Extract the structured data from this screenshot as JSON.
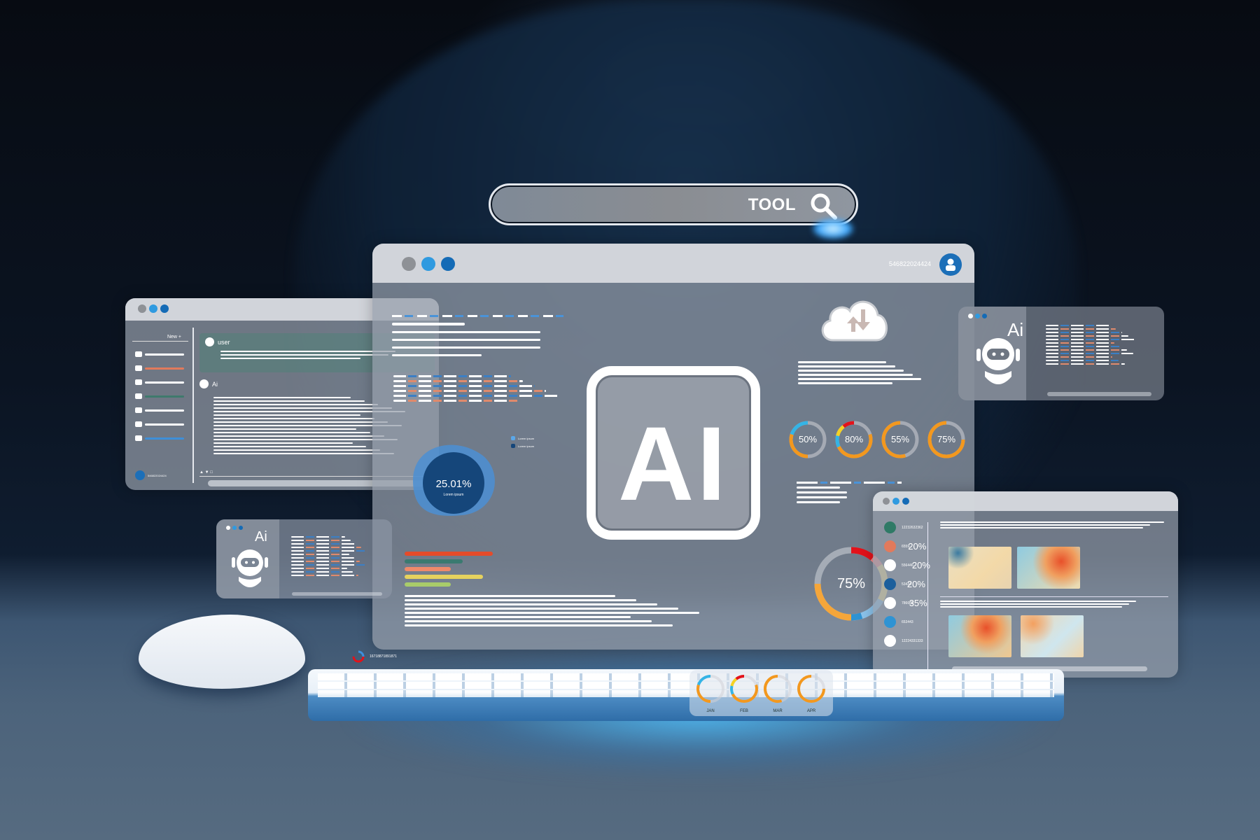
{
  "search": {
    "label": "TOOL",
    "icon": "search-icon"
  },
  "main_window": {
    "user_id": "546822024424",
    "logo_text": "AI",
    "donut": {
      "value": "25.01%",
      "caption": "Lorem ipsum"
    },
    "legend": [
      {
        "label": "Lorem ipsum",
        "color": "#5ba7e8"
      },
      {
        "label": "Lorem ipsum",
        "color": "#15467a"
      }
    ],
    "progress_rings": [
      {
        "label": "50%",
        "value": 50,
        "colors": [
          "#f3981e",
          "#34b4e6"
        ]
      },
      {
        "label": "80%",
        "value": 80,
        "colors": [
          "#f3981e",
          "#34b4e6",
          "#f5d224",
          "#e3121a"
        ]
      },
      {
        "label": "55%",
        "value": 55,
        "colors": [
          "#f3981e"
        ]
      },
      {
        "label": "75%",
        "value": 75,
        "colors": [
          "#f3981e"
        ]
      }
    ],
    "big_ring": {
      "label": "75%",
      "value": 75
    },
    "bar_chart": [
      {
        "color": "#e54b2a",
        "value": 100
      },
      {
        "color": "#3a7a70",
        "value": 66
      },
      {
        "color": "#ee8a6a",
        "value": 52
      },
      {
        "color": "#e6d25e",
        "value": 89
      },
      {
        "color": "#a9cc6a",
        "value": 52
      }
    ],
    "cloud_icon": "cloud-sync-icon"
  },
  "chat_window": {
    "new_label": "New +",
    "user_label": "user",
    "ai_label": "Ai",
    "footer_id": "546822024424",
    "side_item_colors": [
      "#ffffff",
      "#e27a5c",
      "#ffffff",
      "#3f7a6c",
      "#ffffff",
      "#ffffff",
      "#3e8fd8"
    ]
  },
  "ai_card_right": {
    "label": "Ai"
  },
  "ai_card_left": {
    "label": "Ai"
  },
  "lower_right_window": {
    "contacts": [
      {
        "id": "12232632362",
        "color": "#2f7a66"
      },
      {
        "id": "6559...",
        "color": "#e27a5c",
        "pct": "20%"
      },
      {
        "id": "556446...",
        "color": "#ffffff",
        "pct": "20%"
      },
      {
        "id": "53434",
        "color": "#1c5f9c",
        "pct": "20%"
      },
      {
        "id": "786668",
        "color": "#ffffff",
        "pct": "35%"
      },
      {
        "id": "653443",
        "color": "#2f93d3"
      },
      {
        "id": "12224331333",
        "color": "#ffffff"
      }
    ]
  },
  "keyboard_panel": {
    "id_text": "16718871891871",
    "months": [
      {
        "label": "JAN",
        "value": 50
      },
      {
        "label": "FEB",
        "value": 80
      },
      {
        "label": "MAR",
        "value": 55
      },
      {
        "label": "APR",
        "value": 75
      }
    ]
  }
}
